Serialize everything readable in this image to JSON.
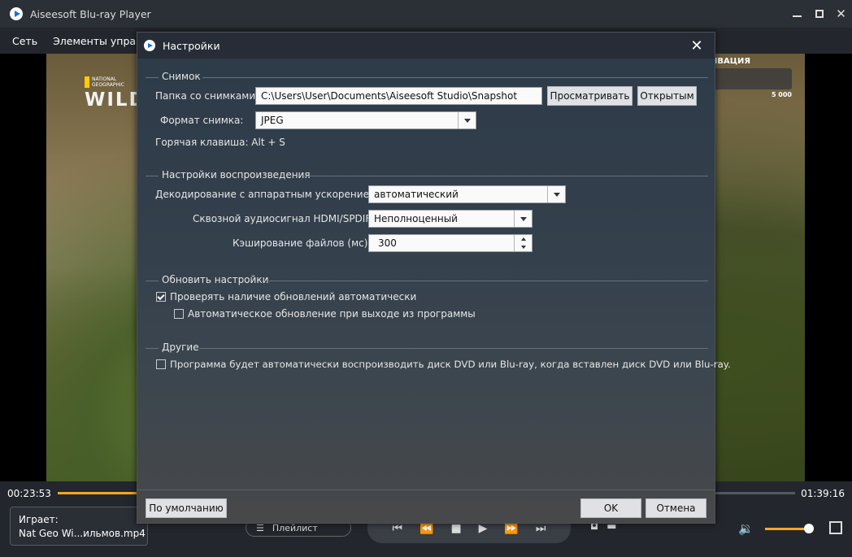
{
  "app": {
    "title": "Aiseesoft Blu-ray Player",
    "menu": [
      "Сеть",
      "Элементы управл"
    ]
  },
  "video": {
    "natgeo_small": "NATIONAL GEOGRAPHIC",
    "natgeo_big": "WILD",
    "overlay_label": "ИВАЦИЯ",
    "overlay_number": "5 000"
  },
  "player": {
    "time_current": "00:23:53",
    "time_total": "01:39:16",
    "progress": 0.235,
    "now_playing_label": "Играет:",
    "now_playing_file": "Nat Geo Wi...ильмов.mp4",
    "playlist_label": "Плейлист",
    "volume": 0.9,
    "accent_color": "#f5a623"
  },
  "dialog": {
    "title": "Настройки",
    "snapshot": {
      "section_title": "Снимок",
      "folder_label": "Папка со снимками:",
      "folder_value": "C:\\Users\\User\\Documents\\Aiseesoft Studio\\Snapshot",
      "browse_button": "Просматривать",
      "open_button": "Открытым",
      "format_label": "Формат снимка:",
      "format_value": "JPEG",
      "hotkey_text": "Горячая клавиша: Alt + S"
    },
    "playback": {
      "section_title": "Настройки воспроизведения",
      "hw_decode_label": "Декодирование с аппаратным ускорением:",
      "hw_decode_value": "автоматический",
      "passthrough_label": "Сквозной аудиосигнал HDMI/SPDIF:",
      "passthrough_value": "Неполноценный",
      "cache_label": "Кэширование файлов (мс):",
      "cache_value": "300"
    },
    "update": {
      "section_title": "Обновить настройки",
      "check_updates_label": "Проверять наличие обновлений автоматически",
      "check_updates_checked": true,
      "auto_update_label": "Автоматическое обновление при выходе из программы",
      "auto_update_checked": false
    },
    "other": {
      "section_title": "Другие",
      "autoplay_label": "Программа будет автоматически воспроизводить диск DVD или Blu-ray, когда вставлен диск DVD или Blu-ray.",
      "autoplay_checked": false
    },
    "buttons": {
      "default": "По умолчанию",
      "ok": "OK",
      "cancel": "Отмена"
    }
  }
}
